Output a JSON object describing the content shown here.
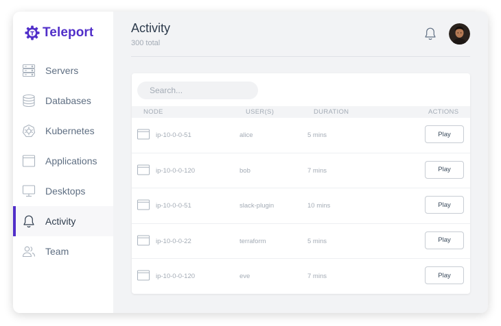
{
  "brand": {
    "name": "Teleport",
    "color": "#512fc9"
  },
  "sidebar": {
    "items": [
      {
        "label": "Servers",
        "icon": "server-icon",
        "active": false
      },
      {
        "label": "Databases",
        "icon": "database-icon",
        "active": false
      },
      {
        "label": "Kubernetes",
        "icon": "kubernetes-icon",
        "active": false
      },
      {
        "label": "Applications",
        "icon": "application-icon",
        "active": false
      },
      {
        "label": "Desktops",
        "icon": "desktop-icon",
        "active": false
      },
      {
        "label": "Activity",
        "icon": "bell-icon",
        "active": true
      },
      {
        "label": "Team",
        "icon": "users-icon",
        "active": false
      }
    ]
  },
  "header": {
    "title": "Activity",
    "count": "300 total",
    "notifications_icon": "bell-icon",
    "avatar_icon": "user-avatar-icon"
  },
  "search": {
    "placeholder": "Search..."
  },
  "table": {
    "columns": [
      "NODE",
      "USER(S)",
      "DURATION",
      "ACTIONS"
    ],
    "rows": [
      {
        "node": "ip-10-0-0-51",
        "user": "alice",
        "duration": "5 mins",
        "action": "Play"
      },
      {
        "node": "ip-10-0-0-120",
        "user": "bob",
        "duration": "7 mins",
        "action": "Play"
      },
      {
        "node": "ip-10-0-0-51",
        "user": "slack-plugin",
        "duration": "10 mins",
        "action": "Play"
      },
      {
        "node": "ip-10-0-0-22",
        "user": "terraform",
        "duration": "5 mins",
        "action": "Play"
      },
      {
        "node": "ip-10-0-0-120",
        "user": "eve",
        "duration": "7 mins",
        "action": "Play"
      }
    ]
  },
  "colors": {
    "accent": "#512fc9",
    "background": "#f2f3f5",
    "text": "#2c3a4b",
    "muted": "#a3abb5"
  }
}
